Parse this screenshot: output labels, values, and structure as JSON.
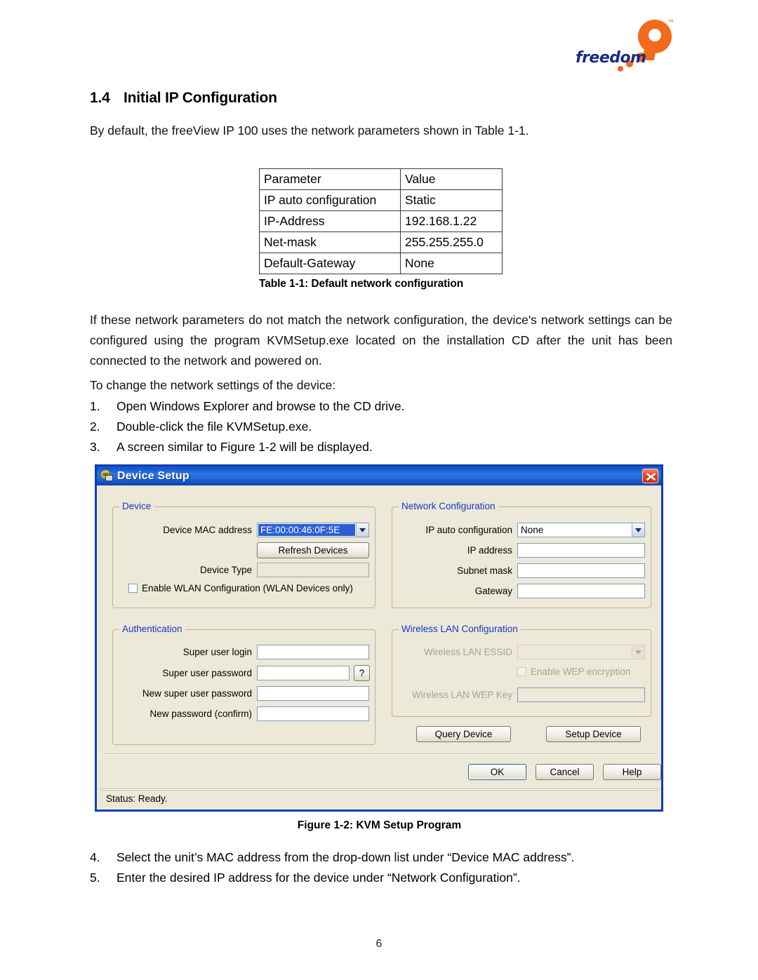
{
  "brand": {
    "word": "freedom",
    "tm": "™"
  },
  "section": {
    "number": "1.4",
    "title": "Initial IP Configuration",
    "intro": "By default, the freeView IP 100 uses the network parameters shown in Table 1-1."
  },
  "table": {
    "headers": [
      "Parameter",
      "Value"
    ],
    "rows": [
      [
        "IP auto configuration",
        "Static"
      ],
      [
        "IP-Address",
        "192.168.1.22"
      ],
      [
        "Net-mask",
        "255.255.255.0"
      ],
      [
        "Default-Gateway",
        "None"
      ]
    ],
    "caption": "Table 1-1: Default network configuration"
  },
  "body": {
    "paragraph1": "If these network parameters do not match the network configuration, the device's network settings can be configured using the program KVMSetup.exe located on the installation CD after the unit has been connected to the network and powered on.",
    "paragraph2": "To change the network settings of the device:",
    "steps_a": [
      {
        "marker": "1.",
        "text": "Open Windows Explorer and browse to the CD drive."
      },
      {
        "marker": "2.",
        "text": "Double-click the file KVMSetup.exe."
      },
      {
        "marker": "3.",
        "text": "A screen similar to Figure 1-2 will be displayed."
      }
    ],
    "steps_b": [
      {
        "marker": "4.",
        "text": "Select the unit’s MAC address from the drop-down list under “Device MAC address”."
      },
      {
        "marker": "5.",
        "text": "Enter the desired IP address for the device under “Network Configuration”."
      }
    ]
  },
  "figure": {
    "caption": "Figure 1-2: KVM Setup Program"
  },
  "dialog": {
    "title": "Device Setup",
    "icon": "device-network-icon",
    "close_icon": "close-icon",
    "device_group": {
      "title": "Device",
      "mac_label": "Device MAC address",
      "mac_value": "FE:00:00:46:0F:5E",
      "refresh_button": "Refresh Devices",
      "device_type_label": "Device Type",
      "device_type_value": "",
      "wlan_checkbox_label": "Enable WLAN Configuration (WLAN Devices only)"
    },
    "network_group": {
      "title": "Network Configuration",
      "ip_auto_label": "IP auto configuration",
      "ip_auto_value": "None",
      "ip_address_label": "IP address",
      "ip_address_value": "",
      "subnet_label": "Subnet mask",
      "subnet_value": "",
      "gateway_label": "Gateway",
      "gateway_value": ""
    },
    "auth_group": {
      "title": "Authentication",
      "super_login_label": "Super user login",
      "super_login_value": "",
      "super_pw_label": "Super user password",
      "super_pw_value": "",
      "help_button": "?",
      "new_pw_label": "New super user password",
      "new_pw_value": "",
      "confirm_pw_label": "New password (confirm)",
      "confirm_pw_value": ""
    },
    "wlan_group": {
      "title": "Wireless LAN Configuration",
      "essid_label": "Wireless LAN ESSID",
      "essid_value": "",
      "wep_checkbox_label": "Enable WEP encryption",
      "wep_key_label": "Wireless LAN WEP Key",
      "wep_key_value": ""
    },
    "action_buttons": {
      "query": "Query Device",
      "setup": "Setup Device"
    },
    "footer_buttons": {
      "ok": "OK",
      "cancel": "Cancel",
      "help": "Help"
    },
    "status": "Status: Ready."
  },
  "page": {
    "number": "6"
  },
  "colors": {
    "titlebar_blue": "#1453cc",
    "dialog_face": "#ece9d8",
    "group_label_blue": "#1437c4",
    "selection_blue": "#2a5fd4",
    "brand_orange": "#f26a1b",
    "brand_blue": "#1b2b86"
  }
}
